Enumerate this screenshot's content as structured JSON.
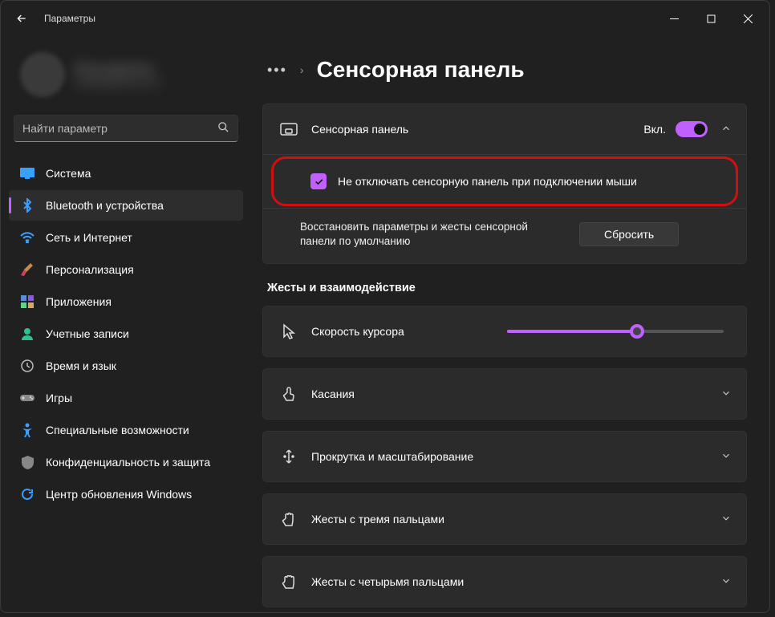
{
  "window": {
    "title": "Параметры"
  },
  "user": {
    "name": "Пользователь",
    "email": "example@mail.com"
  },
  "search": {
    "placeholder": "Найти параметр"
  },
  "sidebar": {
    "items": [
      {
        "label": "Система",
        "icon": "display"
      },
      {
        "label": "Bluetooth и устройства",
        "icon": "bluetooth"
      },
      {
        "label": "Сеть и Интернет",
        "icon": "wifi"
      },
      {
        "label": "Персонализация",
        "icon": "brush"
      },
      {
        "label": "Приложения",
        "icon": "apps"
      },
      {
        "label": "Учетные записи",
        "icon": "person"
      },
      {
        "label": "Время и язык",
        "icon": "clock"
      },
      {
        "label": "Игры",
        "icon": "game"
      },
      {
        "label": "Специальные возможности",
        "icon": "accessibility"
      },
      {
        "label": "Конфиденциальность и защита",
        "icon": "shield"
      },
      {
        "label": "Центр обновления Windows",
        "icon": "update"
      }
    ],
    "active_index": 1
  },
  "breadcrumb": {
    "page": "Сенсорная панель"
  },
  "touchpad": {
    "header_label": "Сенсорная панель",
    "toggle_state_label": "Вкл.",
    "toggle_on": true,
    "keep_on_mouse_label": "Не отключать сенсорную панель при подключении мыши",
    "keep_on_mouse_checked": true,
    "reset_desc": "Восстановить параметры и жесты сенсорной панели по умолчанию",
    "reset_button": "Сбросить"
  },
  "gestures": {
    "heading": "Жесты и взаимодействие",
    "cursor_speed_label": "Скорость курсора",
    "cursor_speed_value": 6,
    "cursor_speed_max": 10,
    "items": [
      {
        "label": "Касания",
        "icon": "tap"
      },
      {
        "label": "Прокрутка и масштабирование",
        "icon": "scroll"
      },
      {
        "label": "Жесты с тремя пальцами",
        "icon": "hand"
      },
      {
        "label": "Жесты с четырьмя пальцами",
        "icon": "hand"
      }
    ]
  }
}
